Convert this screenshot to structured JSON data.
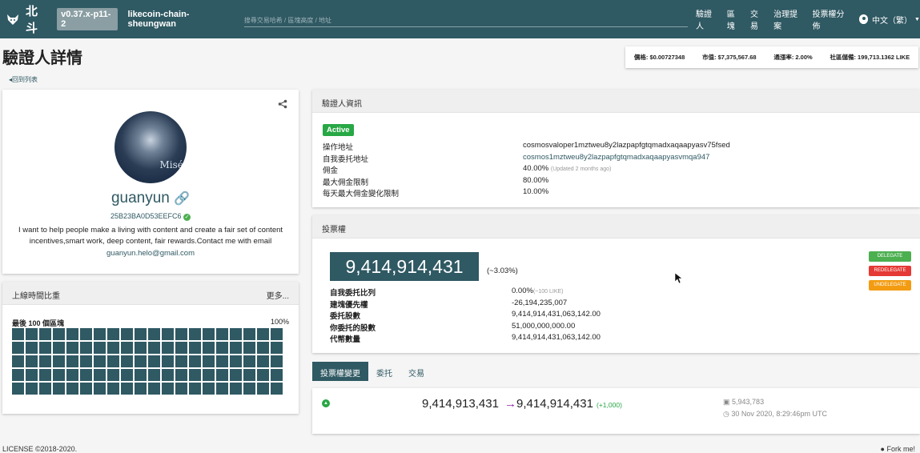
{
  "navbar": {
    "brand": "北斗",
    "version": "v0.37.x-p11-2",
    "chain": "likecoin-chain-sheungwan",
    "search_placeholder": "搜尋交易哈希 / 區塊高度 / 地址",
    "links": [
      "驗證人",
      "區塊",
      "交易",
      "治理提案",
      "投票權分佈"
    ],
    "language": "中文（繁）"
  },
  "header": {
    "title": "驗證人詳情",
    "back": "回到列表",
    "stats": {
      "price": "價格: $0.00727348",
      "market_cap": "市值: $7,375,567.68",
      "inflation": "通漲率: 2.00%",
      "community_pool": "社區儲備: 199,713.1362 LIKE"
    }
  },
  "profile": {
    "avatar_text": "Misérables",
    "moniker": "guanyun",
    "operator_short": "25B23BA0D53EEFC6",
    "details": "I want to help people make a living with content and create a fair set of content incentives,smart work, deep content, fair rewards.Contact me with email",
    "email": "guanyun.helo@gmail.com"
  },
  "uptime": {
    "title": "上線時間比重",
    "more": "更多...",
    "label": "最後 100 個區塊",
    "percent": "100%",
    "blocks_missed": 0
  },
  "info": {
    "title": "驗證人資訊",
    "status": "Active",
    "rows": [
      {
        "key": "操作地址",
        "value": "cosmosvaloper1mztweu8y2lazpapfgtqmadxaqaapyasv75fsed",
        "note": ""
      },
      {
        "key": "自我委托地址",
        "value": "cosmos1mztweu8y2lazpapfgtqmadxaqaapyasvmqa947",
        "note": ""
      },
      {
        "key": "佣金",
        "value": "40.00%",
        "note": "(Updated 2 months ago)"
      },
      {
        "key": "最大佣金限制",
        "value": "80.00%",
        "note": ""
      },
      {
        "key": "每天最大佣金變化限制",
        "value": "10.00%",
        "note": ""
      }
    ]
  },
  "voting_power": {
    "title": "投票權",
    "amount": "9,414,914,431",
    "percent": "(~3.03%)",
    "rows": [
      {
        "key": "自我委托比列",
        "value": "0.00%",
        "note": "(~100 LIKE)"
      },
      {
        "key": "建塊優先權",
        "value": "-26,194,235,007",
        "note": ""
      },
      {
        "key": "委托股數",
        "value": "9,414,914,431,063,142.00",
        "note": ""
      },
      {
        "key": "你委托的股數",
        "value": "51,000,000,000.00",
        "note": ""
      },
      {
        "key": "代幣數量",
        "value": "9,414,914,431,063,142.00",
        "note": ""
      }
    ],
    "buttons": {
      "delegate": "DELEGATE",
      "redelegate": "REDELEGATE",
      "undelegate": "UNDELEGATE"
    }
  },
  "tabs": [
    "投票權變更",
    "委托",
    "交易"
  ],
  "power_event": {
    "from": "9,414,913,431",
    "arrow": "→",
    "to": "9,414,914,431",
    "diff": "(+1,000)",
    "height": "5,943,783",
    "time": "30 Nov 2020, 8:29:46pm UTC"
  },
  "footer": {
    "license": "LICENSE ©2018-2020.",
    "fork": "Fork me!"
  },
  "colors": {
    "primary": "#2f5963",
    "active": "#28a745",
    "delegate": "#4caf50",
    "redelegate": "#e53935",
    "undelegate": "#f39c12"
  }
}
